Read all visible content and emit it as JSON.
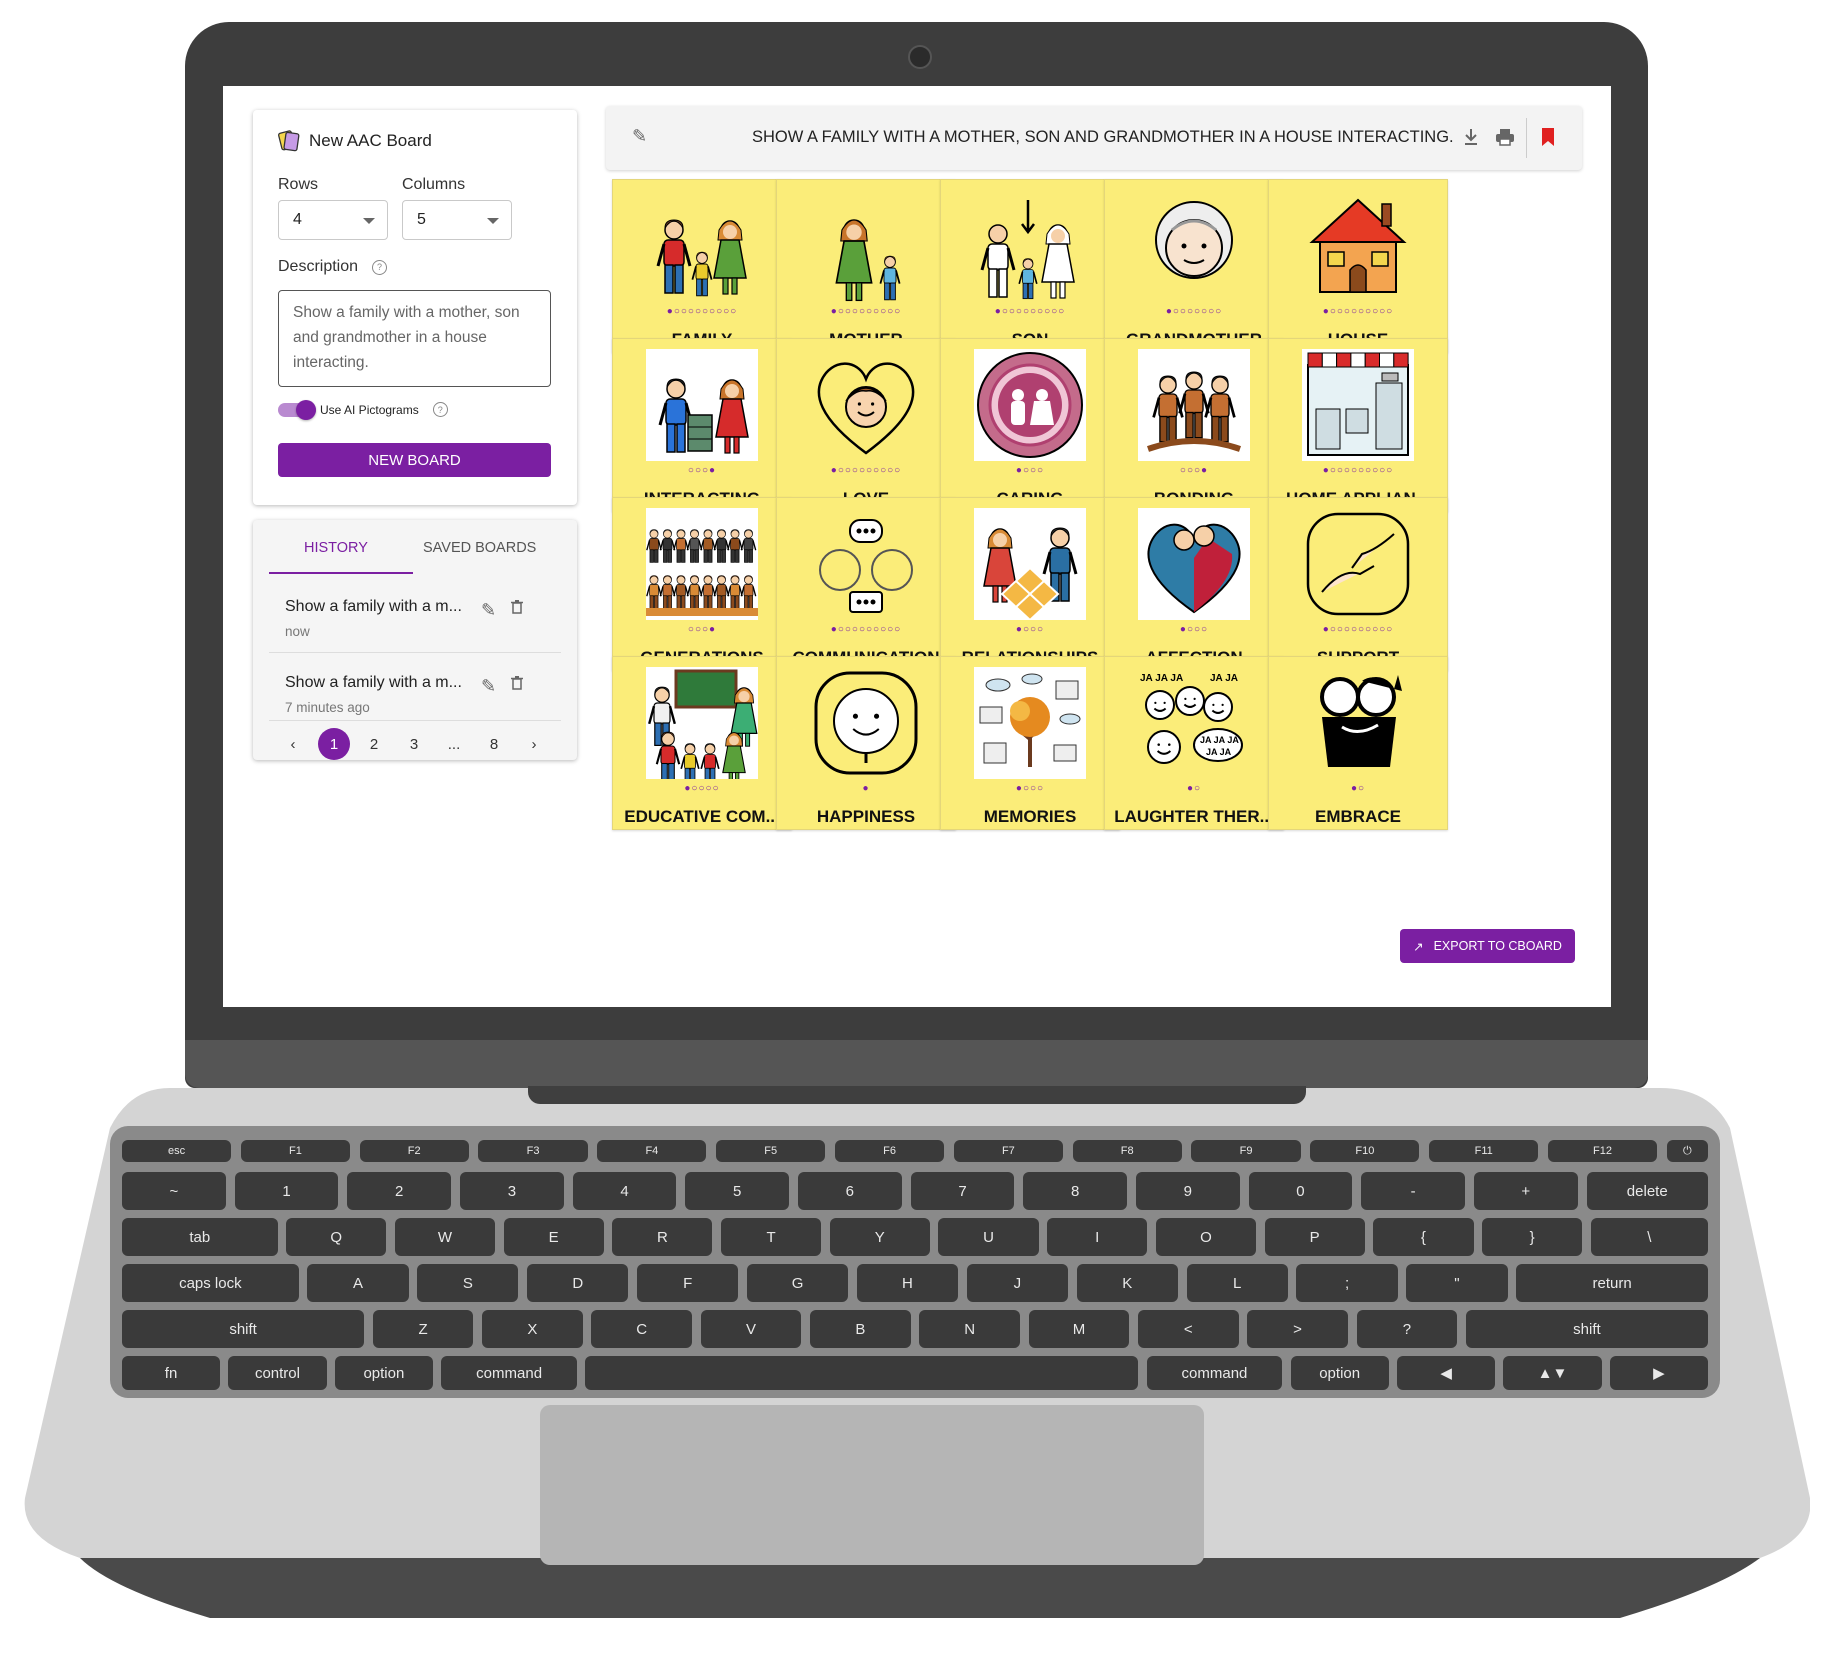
{
  "new_board": {
    "title": "New AAC Board",
    "rows_label": "Rows",
    "rows_value": "4",
    "columns_label": "Columns",
    "columns_value": "5",
    "description_label": "Description",
    "description_value": "Show a family with a mother, son and grandmother in a house interacting.",
    "toggle_label": "Use AI Pictograms",
    "toggle_on": true,
    "button_label": "NEW BOARD"
  },
  "history": {
    "tabs": [
      {
        "label": "HISTORY",
        "active": true
      },
      {
        "label": "SAVED BOARDS",
        "active": false
      }
    ],
    "items": [
      {
        "text": "Show a family with a m...",
        "time": "now"
      },
      {
        "text": "Show a family with a m...",
        "time": "7 minutes ago"
      }
    ],
    "pagination": {
      "pages": [
        "1",
        "2",
        "3",
        "...",
        "8"
      ],
      "current": "1"
    }
  },
  "board": {
    "title": "SHOW A FAMILY WITH A MOTHER, SON AND GRANDMOTHER IN A HOUSE INTERACTING.",
    "icons": [
      "pencil-icon",
      "download-icon",
      "print-icon",
      "bookmark-icon"
    ],
    "tiles": [
      {
        "label": "FAMILY",
        "dots_total": 10,
        "dots_active": 1,
        "icon": "family-icon"
      },
      {
        "label": "MOTHER",
        "dots_total": 10,
        "dots_active": 1,
        "icon": "mother-icon"
      },
      {
        "label": "SON",
        "dots_total": 10,
        "dots_active": 1,
        "icon": "son-icon"
      },
      {
        "label": "GRANDMOTHER",
        "dots_total": 8,
        "dots_active": 1,
        "icon": "grandmother-icon"
      },
      {
        "label": "HOUSE",
        "dots_total": 10,
        "dots_active": 1,
        "icon": "house-icon"
      },
      {
        "label": "INTERACTING",
        "dots_total": 4,
        "dots_active": 4,
        "icon": "interacting-icon"
      },
      {
        "label": "LOVE",
        "dots_total": 10,
        "dots_active": 1,
        "icon": "love-icon"
      },
      {
        "label": "CARING",
        "dots_total": 4,
        "dots_active": 1,
        "icon": "caring-icon"
      },
      {
        "label": "BONDING",
        "dots_total": 4,
        "dots_active": 4,
        "icon": "bonding-icon"
      },
      {
        "label": "HOME APPLIAN...",
        "dots_total": 10,
        "dots_active": 1,
        "icon": "appliances-icon"
      },
      {
        "label": "GENERATIONS",
        "dots_total": 4,
        "dots_active": 4,
        "icon": "generations-icon"
      },
      {
        "label": "COMMUNICATION",
        "dots_total": 10,
        "dots_active": 1,
        "icon": "communication-icon"
      },
      {
        "label": "RELATIONSHIPS",
        "dots_total": 4,
        "dots_active": 1,
        "icon": "relationships-icon"
      },
      {
        "label": "AFFECTION",
        "dots_total": 4,
        "dots_active": 1,
        "icon": "affection-icon"
      },
      {
        "label": "SUPPORT",
        "dots_total": 10,
        "dots_active": 1,
        "icon": "support-icon"
      },
      {
        "label": "EDUCATIVE COM...",
        "dots_total": 5,
        "dots_active": 1,
        "icon": "educative-icon"
      },
      {
        "label": "HAPPINESS",
        "dots_total": 1,
        "dots_active": 1,
        "icon": "happiness-icon"
      },
      {
        "label": "MEMORIES",
        "dots_total": 4,
        "dots_active": 1,
        "icon": "memories-icon"
      },
      {
        "label": "LAUGHTER THER...",
        "dots_total": 2,
        "dots_active": 1,
        "icon": "laughter-icon"
      },
      {
        "label": "EMBRACE",
        "dots_total": 2,
        "dots_active": 1,
        "icon": "embrace-icon"
      }
    ],
    "export_label": "EXPORT TO CBOARD"
  },
  "keyboard": {
    "rows": [
      [
        "esc",
        "F1",
        "F2",
        "F3",
        "F4",
        "F5",
        "F6",
        "F7",
        "F8",
        "F9",
        "F10",
        "F11",
        "F12",
        "⏻"
      ],
      [
        "~",
        "1",
        "2",
        "3",
        "4",
        "5",
        "6",
        "7",
        "8",
        "9",
        "0",
        "-",
        "+",
        "delete"
      ],
      [
        "tab",
        "Q",
        "W",
        "E",
        "R",
        "T",
        "Y",
        "U",
        "I",
        "O",
        "P",
        "{",
        "}",
        "\\"
      ],
      [
        "caps lock",
        "A",
        "S",
        "D",
        "F",
        "G",
        "H",
        "J",
        "K",
        "L",
        ";",
        "\"",
        "return"
      ],
      [
        "shift",
        "Z",
        "X",
        "C",
        "V",
        "B",
        "N",
        "M",
        "<",
        ">",
        "?",
        "shift"
      ],
      [
        "fn",
        "control",
        "option",
        "command",
        "",
        "command",
        "option",
        "◀",
        "▲▼",
        "▶"
      ]
    ]
  },
  "colors": {
    "accent": "#7b1fa2",
    "tile": "#fbed79"
  }
}
